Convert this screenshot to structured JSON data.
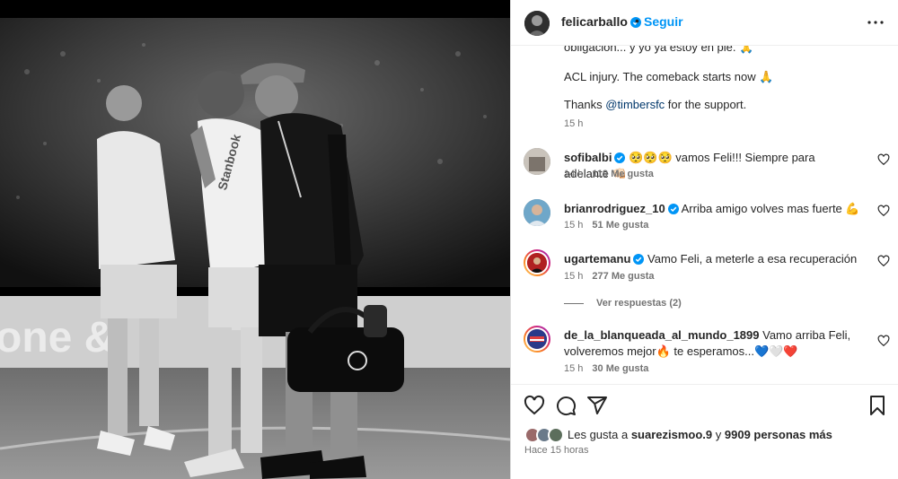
{
  "post": {
    "username": "felicarballo",
    "separator": "•",
    "follow_label": "Seguir"
  },
  "caption": {
    "line1": "obligación... y yo ya estoy en pie. 🙏",
    "line2": "ACL injury. The comeback starts now 🙏",
    "line3_prefix": "Thanks ",
    "line3_mention": "@timbersfc",
    "line3_suffix": " for the support.",
    "time": "15 h"
  },
  "comments": [
    {
      "user": "sofibalbi",
      "text": "🥺🥺🥺 vamos Feli!!! Siempre para adelante 👊🏻",
      "time": "14 h",
      "likes": "119 Me gusta"
    },
    {
      "user": "brianrodriguez_10",
      "text": "Arriba amigo volves mas fuerte 💪",
      "time": "15 h",
      "likes": "51 Me gusta"
    },
    {
      "user": "ugartemanu",
      "text": "Vamo Feli, a meterle a esa recuperación",
      "time": "15 h",
      "likes": "277 Me gusta"
    },
    {
      "user": "de_la_blanqueada_al_mundo_1899",
      "text": "Vamo arriba Feli, volveremos mejor🔥 te esperamos...💙🤍❤️",
      "time": "15 h",
      "likes": "30 Me gusta"
    }
  ],
  "replies_label": "Ver respuestas (2)",
  "likes_bar": {
    "prefix": "Les gusta a ",
    "user": "suarezismoo.9",
    "middle": " y ",
    "count": "9909 personas más"
  },
  "posted_ago": "Hace 15 horas",
  "icons": {
    "verified": "verified-badge-icon",
    "more": "more-options-icon",
    "like": "heart-icon",
    "comment": "comment-icon",
    "share": "share-icon",
    "save": "bookmark-icon"
  },
  "colors": {
    "link": "#0095f6",
    "mention": "#00376b",
    "muted": "#737373",
    "text": "#262626"
  }
}
